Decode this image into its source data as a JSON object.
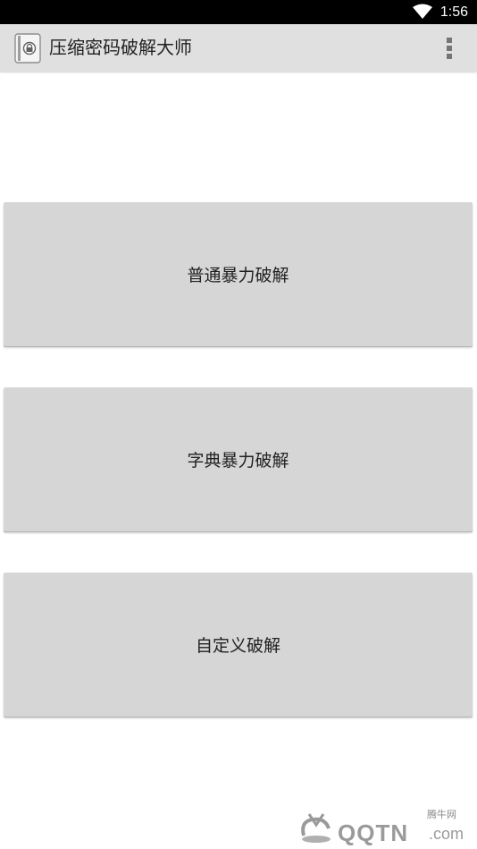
{
  "status_bar": {
    "time": "1:56"
  },
  "app_bar": {
    "title": "压缩密码破解大师",
    "overflow_icon": "more-vert-icon"
  },
  "buttons": [
    {
      "label": "普通暴力破解"
    },
    {
      "label": "字典暴力破解"
    },
    {
      "label": "自定义破解"
    }
  ],
  "watermark": {
    "site_cn": "腾牛网",
    "brand": "QQTN",
    "domain": ".com"
  },
  "colors": {
    "status_bar": "#000000",
    "app_bar": "#e0e0e0",
    "button": "#d6d6d6",
    "text": "#212121"
  }
}
